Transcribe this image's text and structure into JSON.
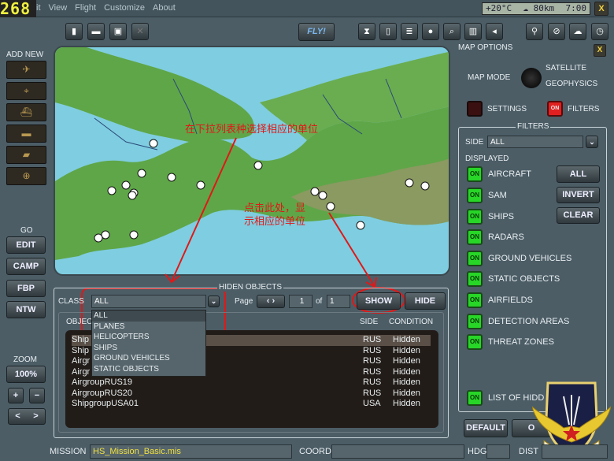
{
  "app": {
    "logo": "268",
    "menu": [
      "it",
      "View",
      "Flight",
      "Customize",
      "About"
    ],
    "weather": {
      "temp": "+20°C",
      "visibility": "☁ 80km",
      "time": "7:00"
    },
    "close": "X"
  },
  "toolbar": {
    "fly": "FLY!",
    "left_icons": [
      "new-file-icon",
      "open-folder-icon",
      "save-icon",
      "close-icon"
    ],
    "mid_icons": [
      "hourglass-icon",
      "document-icon",
      "list-icon",
      "head-icon",
      "search-doc-icon",
      "book-icon",
      "speaker-icon"
    ],
    "right_icons": [
      "binoculars-icon",
      "no-icon",
      "weather-icon",
      "clock-icon"
    ]
  },
  "sidebar": {
    "add_new": "ADD NEW",
    "add_items": [
      "aircraft-icon",
      "helicopter-icon",
      "ship-icon",
      "vehicle-icon",
      "tank-icon",
      "target-icon"
    ],
    "go": "GO",
    "go_buttons": [
      "EDIT",
      "CAMP",
      "FBP",
      "NTW"
    ],
    "zoom": "ZOOM",
    "zoom_value": "100%",
    "plus": "+",
    "minus": "−",
    "prev": "<",
    "next": ">"
  },
  "annotations": {
    "dropdown_hint": "在下拉列表种选择相应的单位",
    "show_hint_1": "点击此处，显",
    "show_hint_2": "示相应的单位"
  },
  "hidden_objects": {
    "title": "HIDEN OBJECTS",
    "class_label": "CLASS",
    "class_value": "ALL",
    "page_label": "Page",
    "page": "1",
    "of_label": "of",
    "pages": "1",
    "show": "SHOW",
    "hide": "HIDE",
    "dropdown": [
      "ALL",
      "PLANES",
      "HELICOPTERS",
      "SHIPS",
      "GROUND VEHICLES",
      "STATIC OBJECTS"
    ],
    "columns": {
      "object": "OBJEC",
      "side": "SIDE",
      "condition": "CONDITION"
    },
    "rows": [
      {
        "name": "Ship",
        "side": "RUS",
        "condition": "Hidden"
      },
      {
        "name": "Ship",
        "side": "RUS",
        "condition": "Hidden"
      },
      {
        "name": "Airgr",
        "side": "RUS",
        "condition": "Hidden"
      },
      {
        "name": "Airgr",
        "side": "RUS",
        "condition": "Hidden"
      },
      {
        "name": "AirgroupRUS19",
        "side": "RUS",
        "condition": "Hidden"
      },
      {
        "name": "AirgroupRUS20",
        "side": "RUS",
        "condition": "Hidden"
      },
      {
        "name": "ShipgroupUSA01",
        "side": "USA",
        "condition": "Hidden"
      }
    ]
  },
  "map_options": {
    "title": "MAP OPTIONS",
    "map_mode": "MAP MODE",
    "satellite": "SATELLITE",
    "geophysics": "GEOPHYSICS",
    "settings": "SETTINGS",
    "filters": "FILTERS",
    "on": "ON"
  },
  "filters": {
    "title": "FILTERS",
    "side_label": "SIDE",
    "side_value": "ALL",
    "displayed": "DISPLAYED",
    "items": [
      "AIRCRAFT",
      "SAM",
      "SHIPS",
      "RADARS",
      "GROUND VEHICLES",
      "STATIC OBJECTS",
      "AIRFIELDS",
      "DETECTION AREAS",
      "THREAT ZONES"
    ],
    "all": "ALL",
    "invert": "INVERT",
    "clear": "CLEAR",
    "list_hidden": "LIST OF HIDD"
  },
  "footer": {
    "default": "DEFAULT",
    "ok": "O",
    "mission_label": "MISSION",
    "mission_value": "HS_Mission_Basic.mis",
    "coord_label": "COORD",
    "hdg_label": "HDG",
    "dist_label": "DIST"
  },
  "colors": {
    "on_green": "#27d627",
    "annotation_red": "#e01818",
    "mission_yellow": "#f0e040"
  }
}
